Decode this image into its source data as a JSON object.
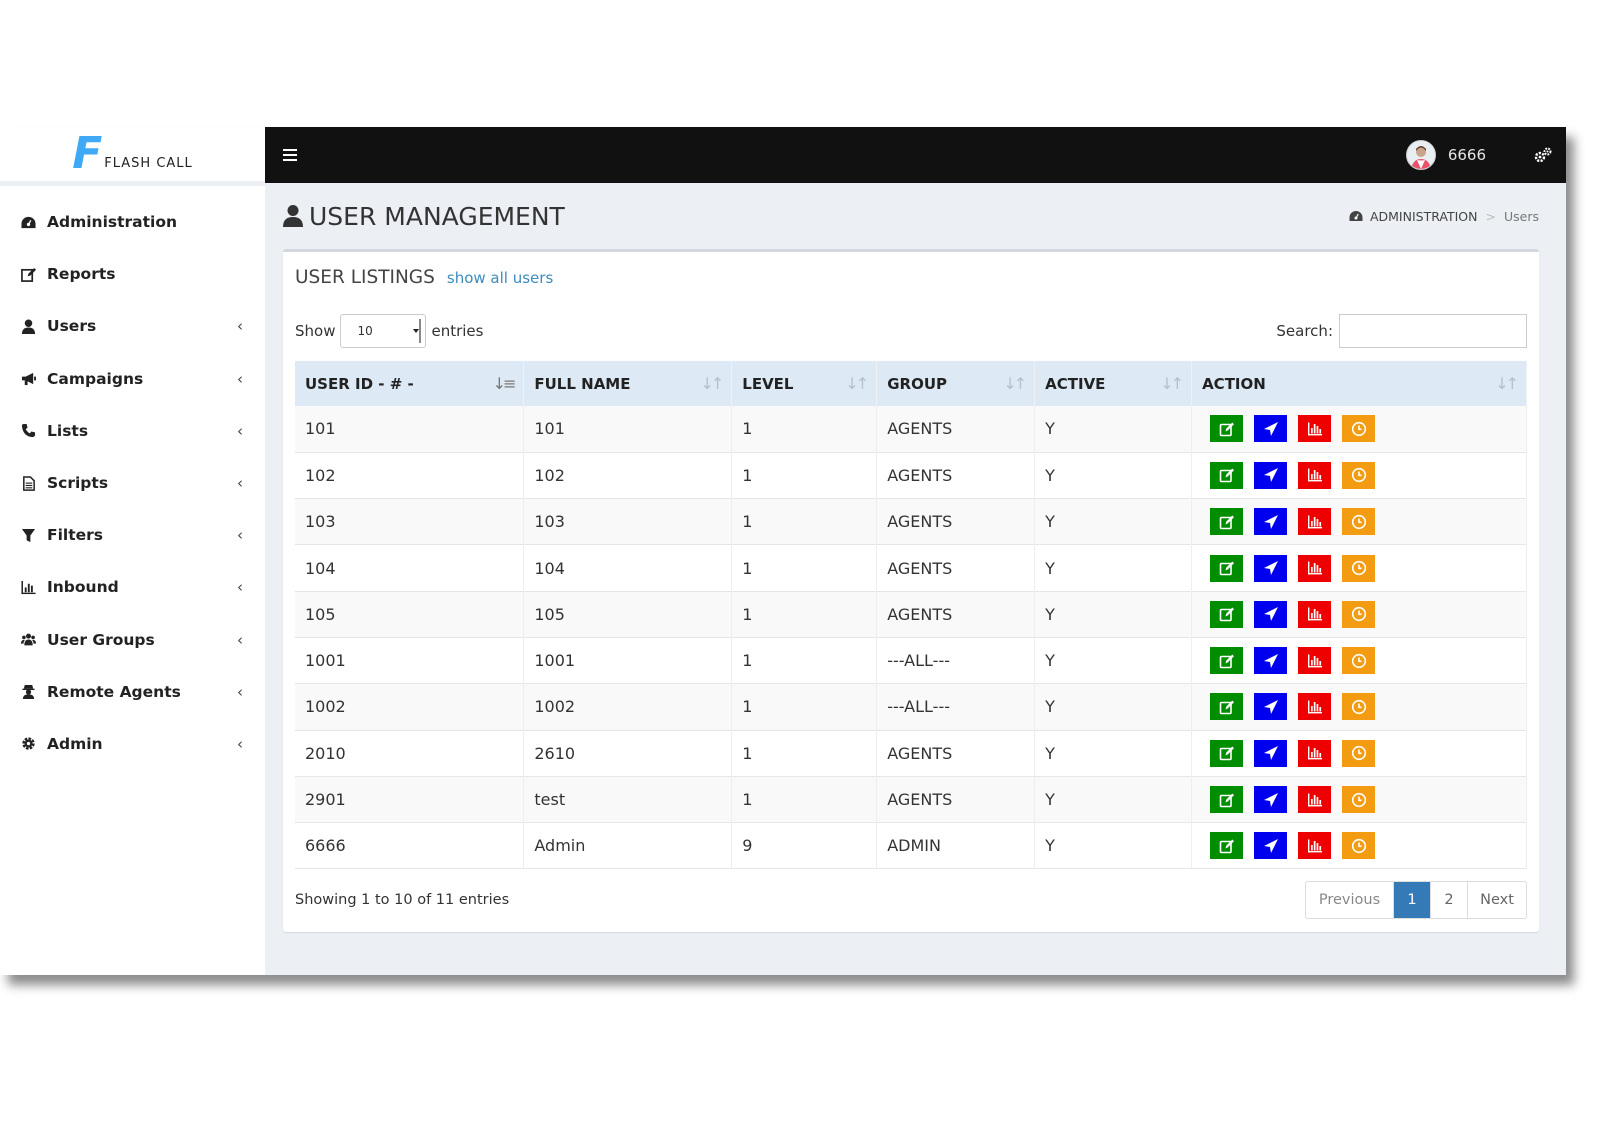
{
  "app": {
    "logo_letter": "F",
    "logo_text": "FLASH CALL",
    "username": "6666"
  },
  "sidebar": {
    "items": [
      {
        "label": "Administration",
        "icon": "dashboard-icon",
        "chevron": ""
      },
      {
        "label": "Reports",
        "icon": "edit-icon",
        "chevron": ""
      },
      {
        "label": "Users",
        "icon": "user-icon",
        "chevron": "‹"
      },
      {
        "label": "Campaigns",
        "icon": "bullhorn-icon",
        "chevron": "‹"
      },
      {
        "label": "Lists",
        "icon": "phone-icon",
        "chevron": "‹"
      },
      {
        "label": "Scripts",
        "icon": "file-icon",
        "chevron": "‹"
      },
      {
        "label": "Filters",
        "icon": "filter-icon",
        "chevron": "‹"
      },
      {
        "label": "Inbound",
        "icon": "bar-chart-icon",
        "chevron": "‹"
      },
      {
        "label": "User Groups",
        "icon": "users-icon",
        "chevron": "‹"
      },
      {
        "label": "Remote Agents",
        "icon": "user-secret-icon",
        "chevron": "‹"
      },
      {
        "label": "Admin",
        "icon": "gear-icon",
        "chevron": "‹"
      }
    ]
  },
  "header": {
    "page_title": "USER MANAGEMENT",
    "breadcrumb": {
      "parent": "ADMINISTRATION",
      "separator": ">",
      "current": "Users"
    }
  },
  "listing": {
    "title": "USER LISTINGS",
    "show_all": "show all users",
    "show_label": "Show",
    "entries_value": "10",
    "entries_label": "entries",
    "search_label": "Search:",
    "search_value": "",
    "columns": [
      "USER ID  - # -",
      "FULL NAME",
      "LEVEL",
      "GROUP",
      "ACTIVE",
      "ACTION"
    ],
    "rows": [
      {
        "id": "101",
        "name": "101",
        "level": "1",
        "group": "AGENTS",
        "active": "Y"
      },
      {
        "id": "102",
        "name": "102",
        "level": "1",
        "group": "AGENTS",
        "active": "Y"
      },
      {
        "id": "103",
        "name": "103",
        "level": "1",
        "group": "AGENTS",
        "active": "Y"
      },
      {
        "id": "104",
        "name": "104",
        "level": "1",
        "group": "AGENTS",
        "active": "Y"
      },
      {
        "id": "105",
        "name": "105",
        "level": "1",
        "group": "AGENTS",
        "active": "Y"
      },
      {
        "id": "1001",
        "name": "1001",
        "level": "1",
        "group": "---ALL---",
        "active": "Y"
      },
      {
        "id": "1002",
        "name": "1002",
        "level": "1",
        "group": "---ALL---",
        "active": "Y"
      },
      {
        "id": "2010",
        "name": "2610",
        "level": "1",
        "group": "AGENTS",
        "active": "Y"
      },
      {
        "id": "2901",
        "name": "test",
        "level": "1",
        "group": "AGENTS",
        "active": "Y"
      },
      {
        "id": "6666",
        "name": "Admin",
        "level": "9",
        "group": "ADMIN",
        "active": "Y"
      }
    ],
    "action_buttons": [
      {
        "icon": "edit-icon",
        "color": "#008d00"
      },
      {
        "icon": "send-icon",
        "color": "#0000ee"
      },
      {
        "icon": "bar-chart-icon",
        "color": "#ee0000"
      },
      {
        "icon": "clock-icon",
        "color": "#f39c12"
      }
    ],
    "summary": "Showing 1 to 10 of 11 entries",
    "pagination": {
      "previous": "Previous",
      "pages": [
        "1",
        "2"
      ],
      "next": "Next"
    }
  },
  "colors": {
    "topbar": "#111111",
    "content_bg": "#ecf0f5",
    "table_header": "#dde9f4",
    "link": "#3c8dbc",
    "pager_active": "#337ab7"
  }
}
